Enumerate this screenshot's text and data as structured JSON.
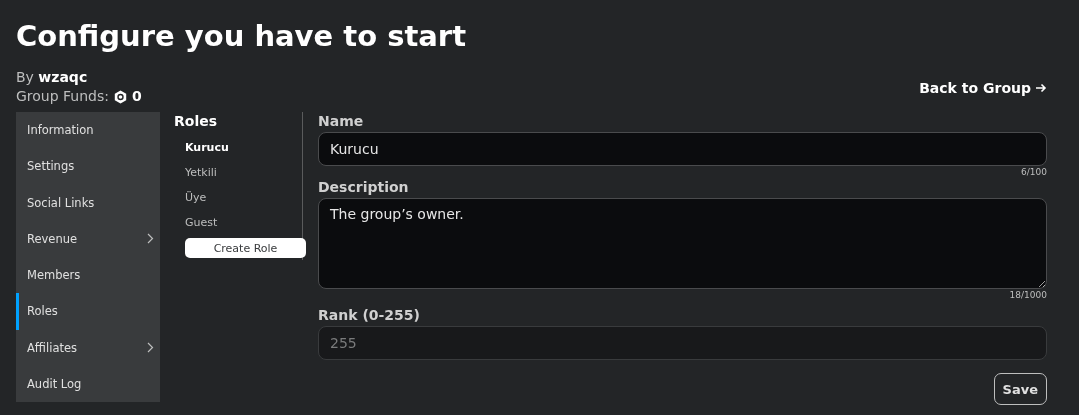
{
  "title": "Configure you have to start",
  "owner": {
    "prefix": "By",
    "name": "wzaqc"
  },
  "funds": {
    "label": "Group Funds:",
    "amount": "0"
  },
  "back_link": "Back to Group",
  "sidebar": {
    "items": [
      {
        "label": "Information",
        "selected": false,
        "expandable": false
      },
      {
        "label": "Settings",
        "selected": false,
        "expandable": false
      },
      {
        "label": "Social Links",
        "selected": false,
        "expandable": false
      },
      {
        "label": "Revenue",
        "selected": false,
        "expandable": true
      },
      {
        "label": "Members",
        "selected": false,
        "expandable": false
      },
      {
        "label": "Roles",
        "selected": true,
        "expandable": false
      },
      {
        "label": "Affiliates",
        "selected": false,
        "expandable": true
      },
      {
        "label": "Audit Log",
        "selected": false,
        "expandable": false
      }
    ]
  },
  "roles": {
    "heading": "Roles",
    "items": [
      {
        "label": "Kurucu",
        "selected": true
      },
      {
        "label": "Yetkili",
        "selected": false
      },
      {
        "label": "Üye",
        "selected": false
      },
      {
        "label": "Guest",
        "selected": false
      }
    ],
    "create_button": "Create Role"
  },
  "form": {
    "fields": [
      {
        "kind": "input",
        "label": "Name",
        "value": "Kurucu",
        "counter": "6/100",
        "disabled": false
      },
      {
        "kind": "textarea",
        "label": "Description",
        "value": "The group’s owner.",
        "counter": "18/1000",
        "disabled": false
      },
      {
        "kind": "input",
        "label": "Rank (0-255)",
        "value": "255",
        "disabled": true
      }
    ],
    "save_button": "Save"
  }
}
